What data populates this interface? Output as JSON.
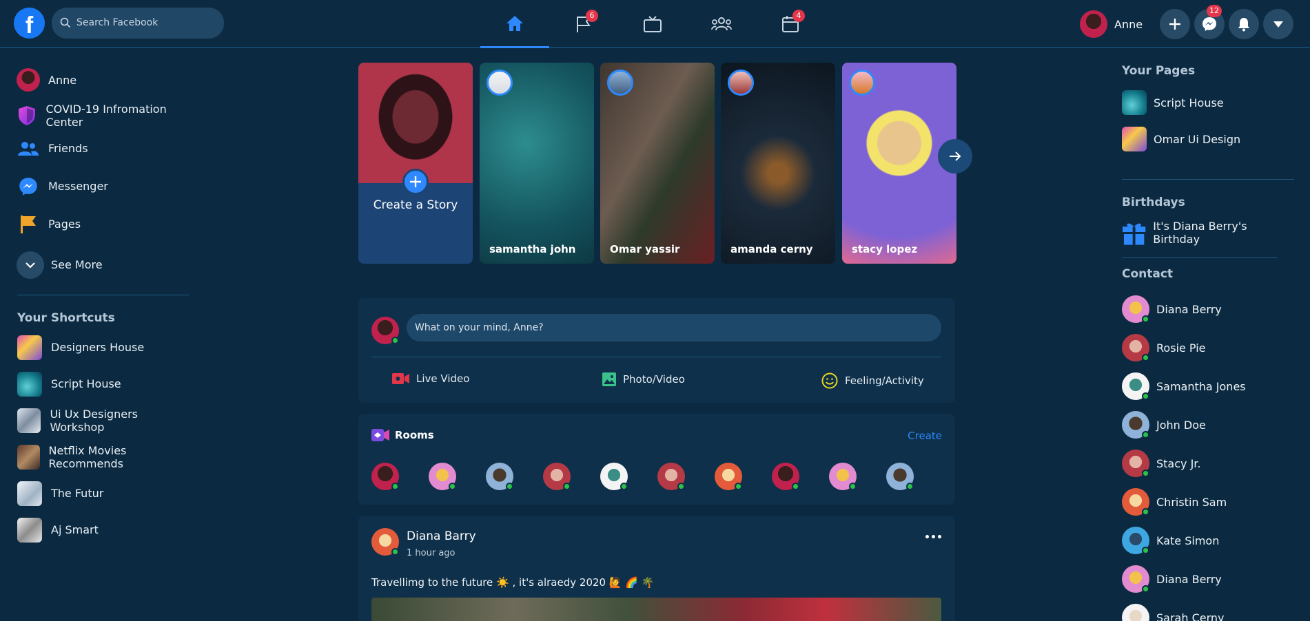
{
  "header": {
    "logo": "f",
    "search_placeholder": "Search Facebook",
    "nav": [
      {
        "icon": "home-icon",
        "badge": ""
      },
      {
        "icon": "flag-icon",
        "badge": "6"
      },
      {
        "icon": "tv-icon",
        "badge": ""
      },
      {
        "icon": "groups-icon",
        "badge": ""
      },
      {
        "icon": "calendar-icon",
        "badge": "4"
      }
    ],
    "user_name": "Anne",
    "messenger_badge": "12"
  },
  "sidebar": {
    "items": [
      {
        "label": "Anne",
        "icon": "user-avatar"
      },
      {
        "label": "COVID-19 Infromation Center",
        "icon": "shield-icon"
      },
      {
        "label": "Friends",
        "icon": "friends-icon"
      },
      {
        "label": "Messenger",
        "icon": "messenger-icon"
      },
      {
        "label": "Pages",
        "icon": "flag-icon"
      }
    ],
    "see_more": "See More",
    "shortcuts_title": "Your Shortcuts",
    "shortcuts": [
      "Designers House",
      "Script House",
      "Ui Ux Designers Workshop",
      "Netflix Movies Recommends",
      "The Futur",
      "Aj Smart"
    ]
  },
  "stories": {
    "create_label": "Create a Story",
    "items": [
      "samantha john",
      "Omar yassir",
      "amanda cerny",
      "stacy lopez"
    ]
  },
  "composer": {
    "placeholder": "What on your mind, Anne?",
    "actions": [
      "Live Video",
      "Photo/Video",
      "Feeling/Activity"
    ]
  },
  "rooms": {
    "title": "Rooms",
    "create": "Create"
  },
  "post": {
    "author": "Diana Barry",
    "time": "1 hour ago",
    "text": "Travellimg to the future ☀️ , it's alraedy 2020 🙋 🌈 🌴"
  },
  "right": {
    "pages_title": "Your Pages",
    "pages": [
      "Script House",
      "Omar Ui Design"
    ],
    "birthdays_title": "Birthdays",
    "birthday_text": "It's Diana Berry's Birthday",
    "contact_title": "Contact",
    "contacts": [
      "Diana Berry",
      "Rosie Pie",
      "Samantha Jones",
      "John Doe",
      "Stacy Jr.",
      "Christin Sam",
      "Kate Simon",
      "Diana Berry",
      "Sarah Cerny"
    ]
  },
  "colors": {
    "accent": "#2e89ff",
    "bg": "#0b2a41",
    "card": "#0e304a",
    "online": "#2bc24a",
    "badge": "#e4364a"
  }
}
